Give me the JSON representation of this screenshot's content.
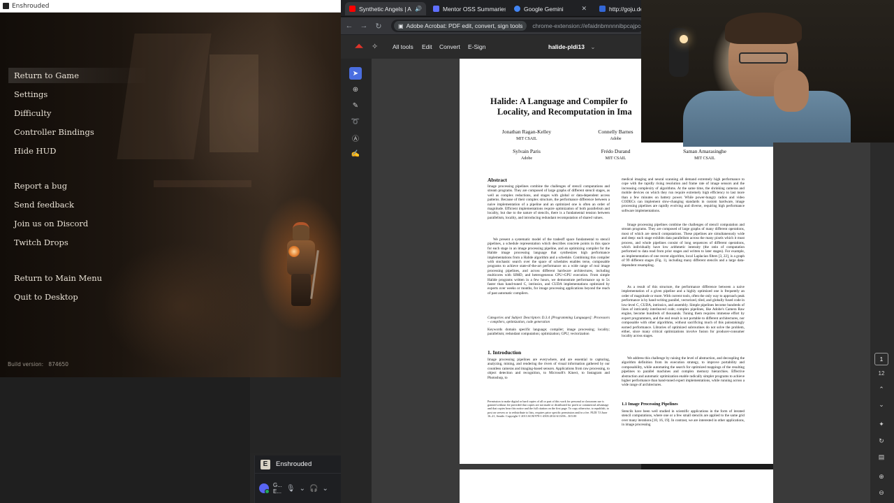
{
  "game": {
    "window_title": "Enshrouded",
    "menu": [
      {
        "label": "Return to Game",
        "selected": true
      },
      {
        "label": "Settings"
      },
      {
        "label": "Difficulty"
      },
      {
        "label": "Controller Bindings"
      },
      {
        "label": "Hide HUD"
      },
      {
        "label": "Report a bug"
      },
      {
        "label": "Send feedback"
      },
      {
        "label": "Join us on Discord"
      },
      {
        "label": "Twitch Drops"
      },
      {
        "label": "Return to Main Menu"
      },
      {
        "label": "Quit to Desktop"
      }
    ],
    "build_label": "Build version:",
    "build_number": "874650"
  },
  "discord": {
    "activity_game": "Enshrouded",
    "user_short": "G...",
    "user_status": "E..."
  },
  "browser": {
    "tabs": [
      {
        "label": "Synthetic Angels | A",
        "color": "#ff0000"
      },
      {
        "label": "Mentor OSS Summaries",
        "color": "#5f6fff"
      },
      {
        "label": "Google Gemini",
        "color": "#4285f4"
      },
      {
        "label": "http://goju.dev",
        "color": "#3367d6"
      }
    ],
    "extension_chip": "Adobe Acrobat: PDF edit, convert, sign tools",
    "url": "chrome-extension://efaidnbmnnnibpcajpcglclefindmk"
  },
  "acrobat": {
    "menu": [
      "All tools",
      "Edit",
      "Convert",
      "E-Sign"
    ],
    "filename": "halide-pldi13",
    "page_current": "1",
    "page_total": "12"
  },
  "paper": {
    "title_line1": "Halide: A Language and Compiler fo",
    "title_line2": "Locality, and Recomputation in Ima",
    "authors": [
      {
        "name": "Jonathan Ragan-Kelley",
        "aff": "MIT CSAIL"
      },
      {
        "name": "Connelly Barnes",
        "aff": "Adobe"
      },
      {
        "name": "Sylvain Paris",
        "aff": "Adobe"
      },
      {
        "name": "Frédo Durand",
        "aff": "MIT CSAIL"
      },
      {
        "name": "Saman Amarasinghe",
        "aff": "MIT CSAIL"
      }
    ],
    "abstract_heading": "Abstract",
    "abstract_text": "Image processing pipelines combine the challenges of stencil computations and stream programs. They are composed of large graphs of different stencil stages, as well as complex reductions, and stages with global or data-dependent access patterns. Because of their complex structure, the performance difference between a naive implementation of a pipeline and an optimized one is often an order of magnitude. Efficient implementations require optimization of both parallelism and locality, but due to the nature of stencils, there is a fundamental tension between parallelism, locality, and introducing redundant recomputation of shared values.",
    "abstract_text2": "We present a systematic model of the tradeoff space fundamental to stencil pipelines, a schedule representation which describes concrete points in this space for each stage in an image processing pipeline, and an optimizing compiler for the Halide image processing language that synthesizes high performance implementations from a Halide algorithm and a schedule. Combining this compiler with stochastic search over the space of schedules enables terse, composable programs to achieve state-of-the-art performance on a wide range of real image processing pipelines, and across different hardware architectures, including multicores with SIMD, and heterogeneous CPU+GPU execution. From simple Halide programs written in a few hours, we demonstrate performance up to 5x faster than hand-tuned C, intrinsics, and CUDA implementations optimized by experts over weeks or months, for image processing applications beyond the reach of past automatic compilers.",
    "categories": "Categories and Subject Descriptors   D.3.4 [Programming Languages]: Processors – compilers, optimization, code generation",
    "keywords": "Keywords   domain specific language; compiler; image processing; locality; parallelism; redundant computation; optimization; GPU; vectorization",
    "intro_heading": "1.   Introduction",
    "intro_text": "Image processing pipelines are everywhere, and are essential to capturing, analyzing, mining, and rendering the rivers of visual information gathered by our countless cameras and imaging-based sensors. Applications from raw processing, to object detection and recognition, to Microsoft's Kinect, to Instagram and Photoshop, to",
    "footnote": "Permission to make digital or hard copies of all or part of this work for personal or classroom use is granted without fee provided that copies are not made or distributed for profit or commercial advantage and that copies bear this notice and the full citation on the first page. To copy otherwise, to republish, to post on servers or to redistribute to lists, requires prior specific permission and/or a fee. PLDI '13   June 16–21, Seattle. Copyright © 2013 ACM 978-1-4503-2014-6/13/06... $15.00",
    "right_col": "medical imaging and neural scanning all demand extremely high performance to cope with the rapidly rising resolution and frame rate of image sensors and the increasing complexity of algorithms. At the same time, the shrinking cameras and mobile devices on which they run require extremely high efficiency to last more than a few minutes on battery power. While power-hungry radios and video CODECs can implement slow-changing standards in custom hardware, image processing pipelines are rapidly evolving and diverse, requiring high performance software implementations.",
    "right_col2": "Image processing pipelines combine the challenges of stencil computation and stream programs. They are composed of large graphs of many different operations, most of which are stencil computations. These pipelines are simultaneously wide and deep: each stage exhibits data parallelism across the many pixels which it must process, and whole pipelines consist of long sequences of different operations, which individually have low arithmetic intensity (the ratio of computation performed to data read from prior stages and written to later stages). For example, an implementation of one recent algorithm, local Laplacian filters [3, 22], is a graph of 99 different stages (Fig. 1), including many different stencils and a large data-dependent resampling.",
    "right_col3": "As a result of this structure, the performance difference between a naive implementation of a given pipeline and a highly optimized one is frequently an order of magnitude or more. With current tools, often the only way to approach peak performance is by hand-writing parallel, vectorized, tiled, and globally fused code in low-level C, CUDA, intrinsics, and assembly. Simple pipelines become hundreds of lines of intricately interleaved code; complex pipelines, like Adobe's Camera Raw engine, become hundreds of thousands. Tuning them requires immense effort by expert programmers, and the end result is not portable to different architectures, nor composable with other algorithms, without sacrificing much of this painstakingly earned performance. Libraries of optimized subroutines do not solve the problem, either, since many critical optimizations involve fusion for producer-consumer locality across stages.",
    "right_col4": "We address this challenge by raising the level of abstraction, and decoupling the algorithm definition from its execution strategy, to improve portability and composability, while automating the search for optimized mappings of the resulting pipelines to parallel machines and complex memory hierarchies. Effective abstraction and automatic optimization enable radically simpler programs to achieve higher performance than hand-tuned expert implementations, while running across a wide range of architectures.",
    "sub_heading": "1.1   Image Processing Pipelines",
    "sub_text": "Stencils have been well studied in scientific applications in the form of iterated stencil computations, where one or a few small stencils are applied to the same grid over many iterations [10, 16, 19]. In contrast, we are interested in other applications, in image processing"
  }
}
